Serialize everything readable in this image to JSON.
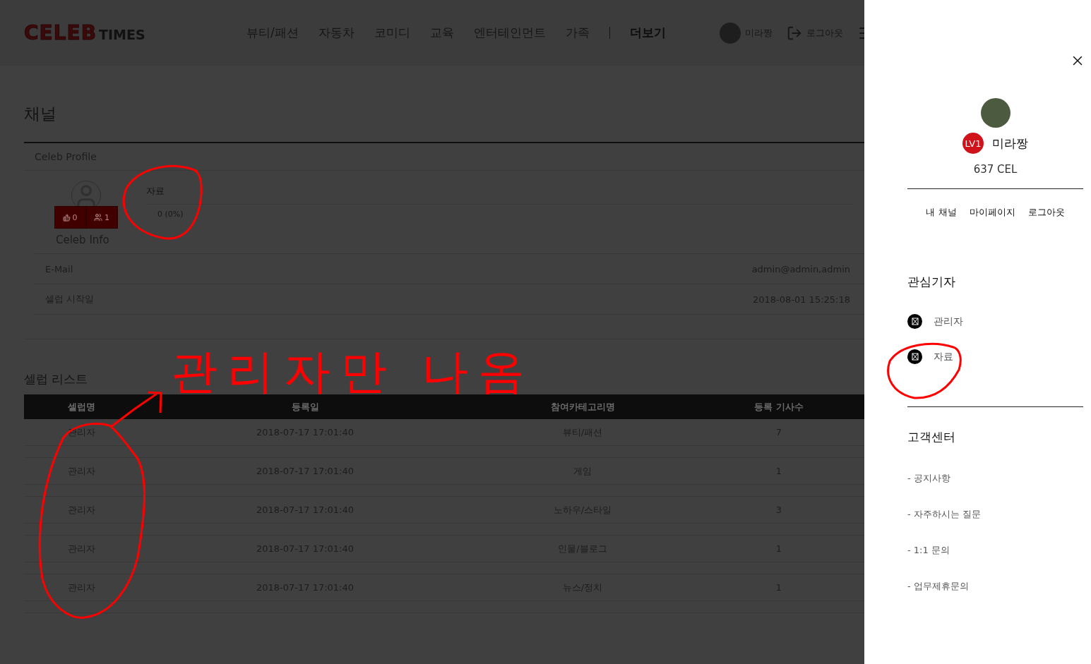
{
  "header": {
    "logo": {
      "main": "CELEB",
      "sub": "TIMES"
    },
    "nav": [
      "뷰티/패션",
      "자동차",
      "코미디",
      "교육",
      "엔터테인먼트",
      "가족"
    ],
    "more": "더보기",
    "user": "미라짱",
    "logout": "로그아웃"
  },
  "page": {
    "title": "채널",
    "profile_heading": "Celeb Profile",
    "likes": "0",
    "followers": "1",
    "category": {
      "name": "자료",
      "count": "0 (0%)"
    },
    "info_heading": "Celeb Info",
    "info": [
      {
        "label": "E-Mail",
        "value": "admin@admin,admin"
      },
      {
        "label": "셀럽 시작일",
        "value": "2018-08-01 15:25:18"
      }
    ]
  },
  "list": {
    "title": "셀럽 리스트",
    "columns": [
      "셀럽명",
      "등록일",
      "참여카테고리명",
      "등록 기사수"
    ],
    "rows": [
      [
        "관리자",
        "2018-07-17 17:01:40",
        "뷰티/패션",
        "7"
      ],
      [
        "관리자",
        "2018-07-17 17:01:40",
        "게임",
        "1"
      ],
      [
        "관리자",
        "2018-07-17 17:01:40",
        "노하우/스타일",
        "3"
      ],
      [
        "관리자",
        "2018-07-17 17:01:40",
        "인물/블로그",
        "1"
      ],
      [
        "관리자",
        "2018-07-17 17:01:40",
        "뉴스/정치",
        "1"
      ]
    ]
  },
  "drawer": {
    "level": "LV1",
    "name": "미라짱",
    "points": "637 CEL",
    "links": [
      "내 채널",
      "마이페이지",
      "로그아웃"
    ],
    "favorites": {
      "title": "관심기자",
      "items": [
        "관리자",
        "자료"
      ]
    },
    "support": {
      "title": "고객센터",
      "items": [
        "- 공지사항",
        "- 자주하시는 질문",
        "- 1:1 문의",
        "- 업무제휴문의"
      ]
    }
  },
  "annotation": {
    "note": "관리자만 나옴"
  }
}
